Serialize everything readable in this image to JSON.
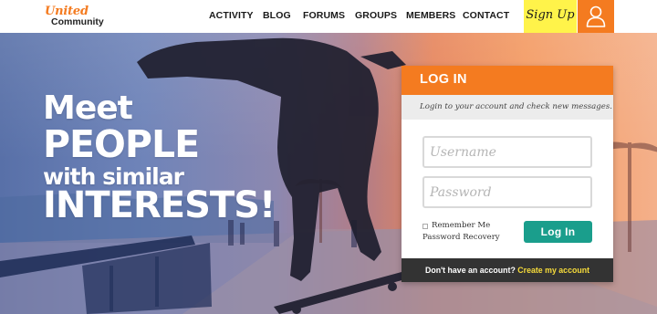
{
  "brand": {
    "line1": "United",
    "line2": "Community"
  },
  "nav": {
    "items": [
      {
        "id": "activity",
        "label": "ACTIVITY"
      },
      {
        "id": "blog",
        "label": "BLOG"
      },
      {
        "id": "forums",
        "label": "FORUMS"
      },
      {
        "id": "groups",
        "label": "GROUPS"
      },
      {
        "id": "members",
        "label": "MEMBERS"
      },
      {
        "id": "contact",
        "label": "CONTACT"
      }
    ],
    "signup_label": "Sign Up",
    "user_icon": "user-icon"
  },
  "hero": {
    "line1": "Meet",
    "line2": "PEOPLE",
    "line3": "with similar",
    "line4": "INTERESTS!"
  },
  "login": {
    "title": "LOG IN",
    "subtitle": "Login to your account and check new messages.",
    "username_placeholder": "Username",
    "password_placeholder": "Password",
    "remember_label": "Remember Me",
    "recovery_label": "Password Recovery",
    "button_label": "Log In",
    "footer_question": "Don't have an account?",
    "footer_link": "Create my account"
  },
  "colors": {
    "accent_orange": "#f47b20",
    "signup_yellow": "#fff34a",
    "login_teal": "#1a9e8c",
    "footer_dark": "#333333",
    "link_yellow": "#f7dc3b"
  }
}
